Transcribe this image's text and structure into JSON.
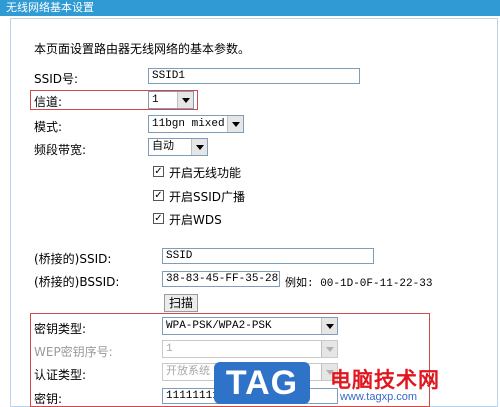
{
  "title": "无线网络基本设置",
  "description": "本页面设置路由器无线网络的基本参数。",
  "ssid": {
    "label": "SSID号:",
    "value": "SSID1"
  },
  "channel": {
    "label": "信道:",
    "value": "1"
  },
  "mode": {
    "label": "模式:",
    "value": "11bgn mixed"
  },
  "bandwidth": {
    "label": "频段带宽:",
    "value": "自动"
  },
  "checkboxes": {
    "enable_wireless": {
      "label": "开启无线功能",
      "checked": true
    },
    "ssid_broadcast": {
      "label": "开启SSID广播",
      "checked": true
    },
    "wds": {
      "label": "开启WDS",
      "checked": true
    }
  },
  "bridge_ssid": {
    "label": "(桥接的)SSID:",
    "value": "SSID"
  },
  "bridge_bssid": {
    "label": "(桥接的)BSSID:",
    "value": "38-83-45-FF-35-28",
    "example": "例如: 00-1D-0F-11-22-33"
  },
  "scan_button": "扫描",
  "key_type": {
    "label": "密钥类型:",
    "value": "WPA-PSK/WPA2-PSK"
  },
  "wep_index": {
    "label": "WEP密钥序号:",
    "value": "1"
  },
  "auth_type": {
    "label": "认证类型:",
    "value": "开放系统"
  },
  "key": {
    "label": "密钥:",
    "value": "1111111111"
  },
  "watermark": {
    "logo": "TAG",
    "site_name": "电脑技术网",
    "url": "www.tagxp.com"
  },
  "colors": {
    "titlebar": "#2f9ad3",
    "highlight_border": "#d24a4a",
    "watermark_red": "#e0171e",
    "watermark_blue": "#2f73c9"
  }
}
